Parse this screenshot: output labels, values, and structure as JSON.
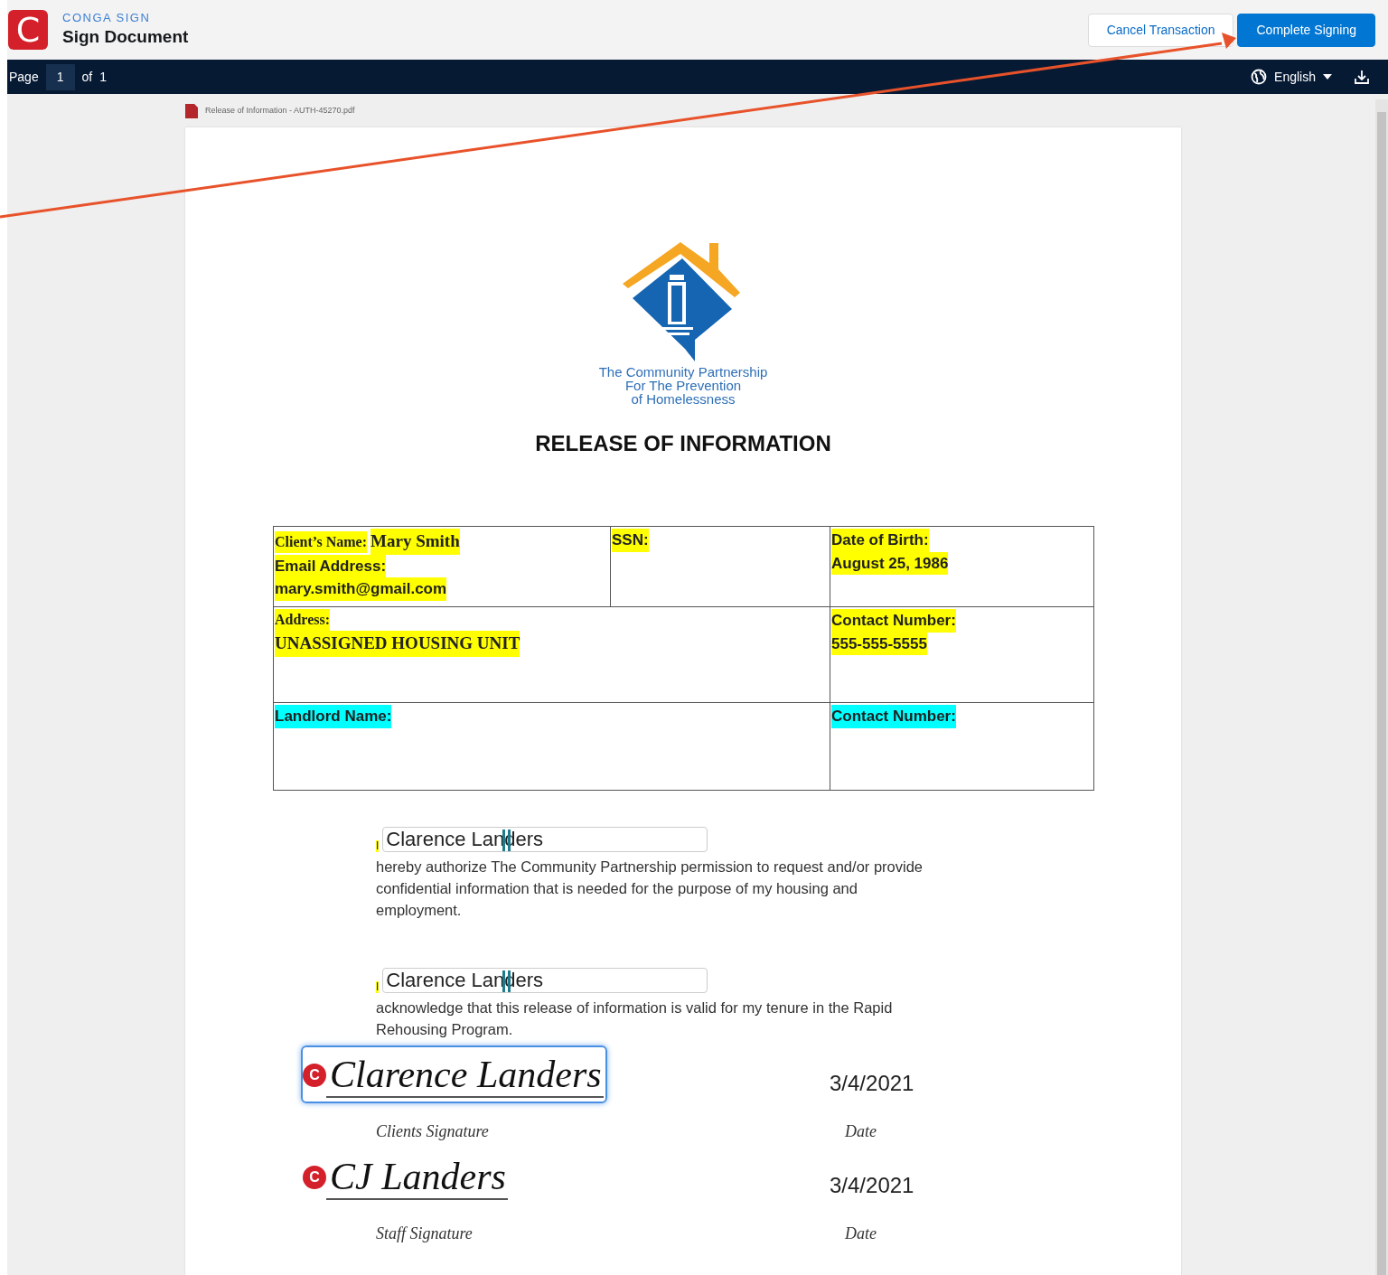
{
  "app": {
    "logo_letter": "C",
    "brand": "CONGA SIGN",
    "title": "Sign Document"
  },
  "actions": [
    {
      "label": "Cancel Transaction",
      "kind": "secondary"
    },
    {
      "label": "Complete Signing",
      "kind": "primary"
    }
  ],
  "pager": {
    "label": "Page",
    "current": "1",
    "of_label": "of",
    "total": "1"
  },
  "language": "English",
  "document": {
    "filename": "Release of Information - AUTH-45270.pdf",
    "logo_text": [
      "The Community Partnership",
      "For The Prevention",
      "of Homelessness"
    ],
    "heading": "RELEASE OF INFORMATION",
    "table": [
      [
        {
          "lines": [
            [
              {
                "text": "Client’s Name:",
                "kind": "serif",
                "color": "#ffff00"
              },
              {
                "text": "Mary Smith",
                "kind": "serif-large",
                "color": "#ffff00"
              }
            ],
            [
              {
                "text": "Email Address:",
                "kind": "sans",
                "color": "#ffff00"
              }
            ],
            [
              {
                "text": "mary.smith@gmail.com",
                "kind": "sans",
                "color": "#ffff00"
              }
            ]
          ]
        },
        {
          "lines": [
            [
              {
                "text": "SSN:",
                "kind": "sans",
                "color": "#ffff00"
              }
            ]
          ]
        },
        {
          "lines": [
            [
              {
                "text": "Date of Birth:",
                "kind": "sans",
                "color": "#ffff00"
              }
            ],
            [
              {
                "text": "August 25, 1986",
                "kind": "sans",
                "color": "#ffff00"
              }
            ]
          ]
        }
      ],
      [
        {
          "lines": [
            [
              {
                "text": "Address:",
                "kind": "serif",
                "color": "#ffff00"
              }
            ],
            [
              {
                "text": "UNASSIGNED HOUSING UNIT",
                "kind": "serif-large",
                "color": "#ffff00"
              }
            ]
          ]
        },
        {
          "lines": [
            [
              {
                "text": "Contact Number:",
                "kind": "sans",
                "color": "#ffff00"
              }
            ],
            [
              {
                "text": "555-555-5555",
                "kind": "sans",
                "color": "#ffff00"
              }
            ]
          ]
        }
      ],
      [
        {
          "lines": [
            [
              {
                "text": "Landlord Name:",
                "kind": "sans",
                "color": "#00ffff"
              }
            ]
          ]
        },
        {
          "lines": [
            [
              {
                "text": "Contact Number:",
                "kind": "sans",
                "color": "#00ffff"
              }
            ]
          ]
        }
      ]
    ],
    "clauses": [
      {
        "prefix": "I",
        "name": "Clarence Landers",
        "text": "hereby authorize The Community Partnership permission to request and/or provide confidential information that is needed for the purpose of my housing and employment."
      },
      {
        "prefix": "I",
        "name": "Clarence Landers",
        "text": "acknowledge that this release of information is valid for my tenure in the Rapid Rehousing Program."
      }
    ],
    "signatures": [
      {
        "badge": "C",
        "signature": "Clarence Landers",
        "selected": true,
        "date": "3/4/2021",
        "label": "Clients Signature",
        "date_label": "Date"
      },
      {
        "badge": "C",
        "signature": "CJ Landers",
        "selected": false,
        "date": "3/4/2021",
        "label": "Staff Signature",
        "date_label": "Date"
      }
    ]
  }
}
